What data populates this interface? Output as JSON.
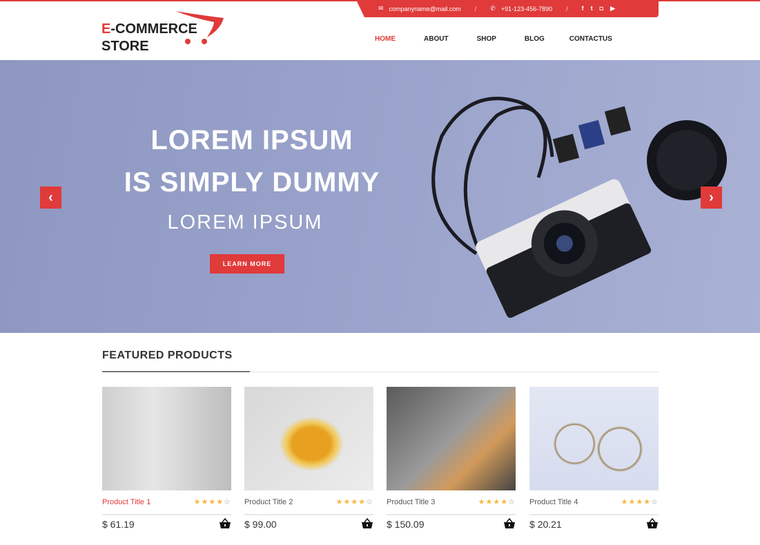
{
  "topbar": {
    "email": "companyname@mail.com",
    "phone": "+91-123-456-7890",
    "social": [
      "f",
      "t",
      "ig",
      "yt"
    ]
  },
  "logo": {
    "e": "E",
    "rest": "-COMMERCE",
    "line2": "STORE"
  },
  "nav": [
    "HOME",
    "ABOUT",
    "SHOP",
    "BLOG",
    "CONTACTUS"
  ],
  "nav_active": "HOME",
  "hero": {
    "line1": "LOREM IPSUM",
    "line2": "IS SIMPLY DUMMY",
    "line3": "LOREM IPSUM",
    "button": "LEARN MORE",
    "prev": "‹",
    "next": "›"
  },
  "featured": {
    "title": "FEATURED PRODUCTS"
  },
  "products": [
    {
      "title": "Product Title 1",
      "price": "$ 61.19",
      "rating": 4,
      "active": true
    },
    {
      "title": "Product Title 2",
      "price": "$ 99.00",
      "rating": 4
    },
    {
      "title": "Product Title 3",
      "price": "$ 150.09",
      "rating": 4
    },
    {
      "title": "Product Title 4",
      "price": "$ 20.21",
      "rating": 4
    }
  ],
  "colors": {
    "accent": "#e03a3a",
    "hero_bg": "#9aa3cb"
  }
}
